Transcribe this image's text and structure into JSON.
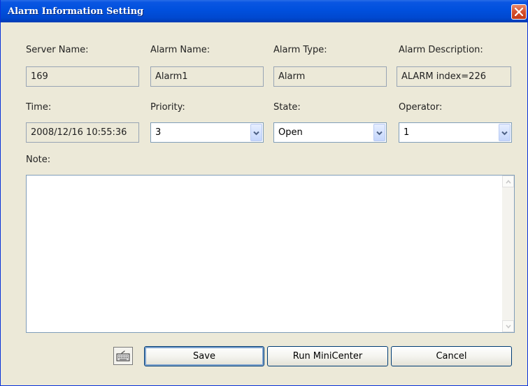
{
  "window": {
    "title": "Alarm Information Setting"
  },
  "fields": {
    "server_name": {
      "label": "Server Name:",
      "value": "169"
    },
    "alarm_name": {
      "label": "Alarm Name:",
      "value": "Alarm1"
    },
    "alarm_type": {
      "label": "Alarm Type:",
      "value": "Alarm"
    },
    "alarm_description": {
      "label": "Alarm Description:",
      "value": "ALARM index=226"
    },
    "time": {
      "label": "Time:",
      "value": "2008/12/16 10:55:36"
    },
    "priority": {
      "label": "Priority:",
      "value": "3"
    },
    "state": {
      "label": "State:",
      "value": "Open"
    },
    "operator": {
      "label": "Operator:",
      "value": "1"
    }
  },
  "note": {
    "label": "Note:",
    "value": ""
  },
  "buttons": {
    "keyboard_icon": "keyboard-icon",
    "save": "Save",
    "run_minicenter": "Run MiniCenter",
    "cancel": "Cancel"
  },
  "colors": {
    "titlebar": "#0050dd",
    "dialog_bg": "#ece9d8",
    "close_button": "#d4502d"
  }
}
